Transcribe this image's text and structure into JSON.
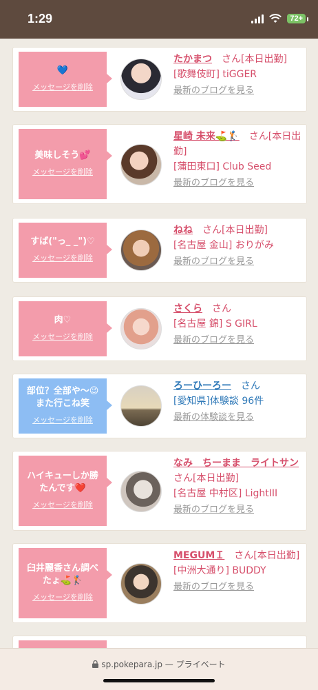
{
  "status": {
    "time": "1:29",
    "battery": "72+"
  },
  "cards": [
    {
      "message": "💙",
      "delete_label": "メッセージを削除",
      "name": "たかまつ",
      "san": "さん",
      "tag": "[本日出勤]",
      "shop": "[歌舞伎町] tiGGER",
      "blog": "最新のブログを見る"
    },
    {
      "message": "美味しそう💕",
      "delete_label": "メッセージを削除",
      "name": "星崎 未来⛳🏌️",
      "san": "さん",
      "tag": "[本日出勤]",
      "shop": "[蒲田東口] Club Seed",
      "blog": "最新のブログを見る"
    },
    {
      "message": "すば(\"っ_ _\")♡",
      "delete_label": "メッセージを削除",
      "name": "ねね",
      "san": "さん",
      "tag": "[本日出勤]",
      "shop": "[名古屋 金山] おりがみ",
      "blog": "最新のブログを見る"
    },
    {
      "message": "肉♡",
      "delete_label": "メッセージを削除",
      "name": "さくら",
      "san": "さん",
      "tag": "",
      "shop": "[名古屋 錦] S GIRL",
      "blog": "最新のブログを見る"
    },
    {
      "message": "部位？全部や〜😉また行こね笑",
      "delete_label": "メッセージを削除",
      "name": "ろーひーろー",
      "san": "さん",
      "tag": "",
      "shop": "[愛知県]体験談 96件",
      "blog": "最新の体験談を見る"
    },
    {
      "message": "ハイキューしか勝たんです❤️",
      "delete_label": "メッセージを削除",
      "name": "なみ　ちーまま　ライトサン",
      "san": "さん",
      "tag": "[本日出勤]",
      "shop": "[名古屋 中村区] LightIII",
      "blog": "最新のブログを見る"
    },
    {
      "message": "臼井麗香さん調べたょ⛳🏌️",
      "delete_label": "メッセージを削除",
      "name": "MEGUMＩ",
      "san": "さん",
      "tag": "[本日出勤]",
      "shop": "[中洲大通り] BUDDY",
      "blog": "最新のブログを見る"
    }
  ],
  "browser": {
    "url": "sp.pokepara.jp",
    "mode": "— プライベート"
  },
  "colors": {
    "pink_bubble": "#f39cab",
    "blue_bubble": "#8dbdf3",
    "name_pink": "#d64f6b",
    "name_blue": "#2f79b8"
  }
}
